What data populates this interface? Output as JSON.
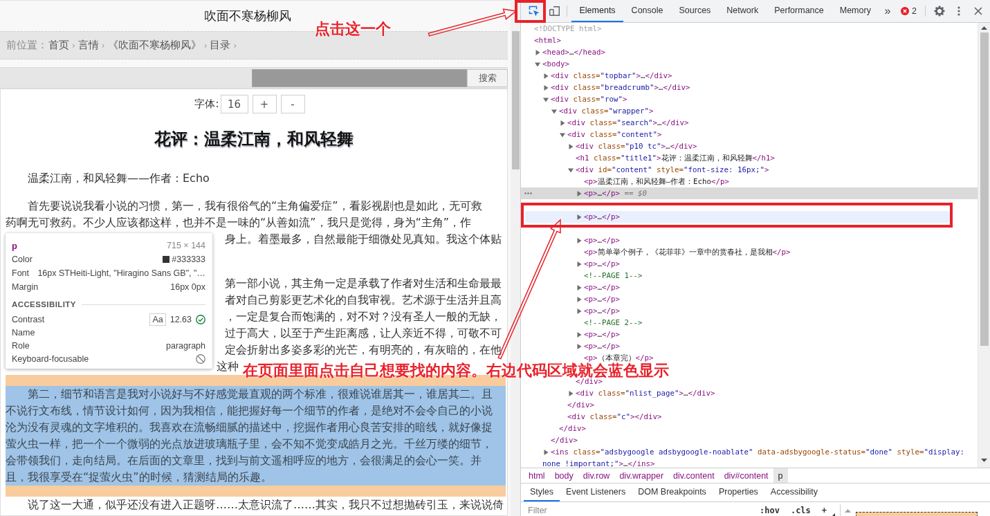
{
  "page": {
    "site_title": "吹面不寒杨柳风",
    "breadcrumb": {
      "label": "前位置：",
      "items": [
        {
          "text": "首页",
          "separator": "›"
        },
        {
          "text": "言情",
          "separator": "›"
        },
        {
          "text": "《吹面不寒杨柳风》",
          "separator": "›"
        },
        {
          "text": "目录",
          "separator": "›"
        }
      ]
    },
    "search": {
      "button": "搜索"
    },
    "font_controls": {
      "label": "字体:",
      "value": "16",
      "buttons": [
        "+",
        "-"
      ]
    },
    "article": {
      "title": "花评：温柔江南，和风轻舞",
      "paragraphs": [
        {
          "highlighted": false,
          "lines": [
            {
              "kind": "full",
              "text": "温柔江南，和风轻舞——作者：Echo"
            }
          ]
        },
        {
          "highlighted": false,
          "lines": [
            {
              "kind": "full",
              "text": "首先要说说我看小说的习惯，第一，我有很俗气的“主角偏爱症”，看影视剧也是如此，无可救"
            },
            {
              "kind": "full",
              "text": "药啊无可救药。不少人应该都这样，也并不是一味的“从善如流”，我只是觉得，身为“主角”，作"
            },
            {
              "kind": "tail",
              "text": "身上。着墨最多，自然最能于细微处见真知。我这个体贴"
            },
            {
              "kind": "covered"
            }
          ]
        },
        {
          "highlighted": false,
          "lines": [
            {
              "kind": "tail",
              "text": "第一部小说，其主角一定是承载了作者对生活和生命最最"
            },
            {
              "kind": "tail",
              "text": "者对自己剪影更艺术化的自我审视。艺术源于生活并且高"
            },
            {
              "kind": "tail",
              "text": "，一定是复合而饱满的，对不对？没有圣人一般的无缺，"
            },
            {
              "kind": "tail",
              "text": "过于高大，以至于产生距离感，让人亲近不得，可敬不可"
            },
            {
              "kind": "tail",
              "text": "定会折射出多姿多彩的光芒，有明亮的，有灰暗的，在他"
            },
            {
              "kind": "middle",
              "text": "这种"
            }
          ]
        },
        {
          "highlighted": true,
          "lines": [
            {
              "kind": "full",
              "text": "第二，细节和语言是我对小说好与不好感觉最直观的两个标准，很难说谁居其一，谁居其二。且"
            },
            {
              "kind": "full",
              "text": "不说行文布线，情节设计如何，因为我相信，能把握好每一个细节的作者，是绝对不会令自己的小说"
            },
            {
              "kind": "full",
              "text": "沦为没有灵魂的文字堆积的。我喜欢在流畅细腻的描述中，挖掘作者用心良苦安排的暗线，就好像捉"
            },
            {
              "kind": "full",
              "text": "萤火虫一样，把一个一个微弱的光点放进玻璃瓶子里，会不知不觉变成皓月之光。千丝万缕的细节，"
            },
            {
              "kind": "full",
              "text": "会带领我们，走向结局。在后面的文章里，找到与前文遥相呼应的地方，会很满足的会心一笑。并"
            },
            {
              "kind": "full",
              "text": "且，我很享受在“捉萤火虫”的时候，猜测结局的乐趣。"
            }
          ]
        },
        {
          "highlighted": false,
          "lines": [
            {
              "kind": "full",
              "text": "说了这一大通，似乎还没有进入正题呀……太意识流了……其实，我只不过想抛砖引玉，来说说倚"
            }
          ]
        }
      ]
    }
  },
  "inspect_tooltip": {
    "tag": "p",
    "size": "715 × 144",
    "rows": [
      {
        "kind": "color",
        "label": "Color",
        "value": "#333333",
        "color": "#333333"
      },
      {
        "kind": "text",
        "label": "Font",
        "value": "16px STHeiti-Light, \"Hiragino Sans GB\", \"…"
      },
      {
        "kind": "text",
        "label": "Margin",
        "value": "16px 0px"
      }
    ],
    "section": "ACCESSIBILITY",
    "a11y_rows": [
      {
        "kind": "contrast",
        "label": "Contrast",
        "sample": "Aa",
        "value": "12.63",
        "passes": true
      },
      {
        "kind": "text",
        "label": "Name"
      },
      {
        "kind": "text",
        "label": "Role",
        "value": "paragraph"
      },
      {
        "kind": "focusable",
        "label": "Keyboard-focusable",
        "focusable": false
      }
    ]
  },
  "devtools": {
    "tools": [
      {
        "kind": "inspect",
        "selected": true,
        "annotated": true
      },
      {
        "kind": "device",
        "selected": false,
        "annotated": false
      }
    ],
    "tabs": [
      {
        "label": "Elements",
        "selected": true
      },
      {
        "label": "Console",
        "selected": false
      },
      {
        "label": "Sources",
        "selected": false
      },
      {
        "label": "Network",
        "selected": false
      },
      {
        "label": "Performance",
        "selected": false
      },
      {
        "label": "Memory",
        "selected": false
      }
    ],
    "more_tabs": "»",
    "error_count": "2",
    "dom_tree": [
      {
        "kind": "doctype",
        "text": "<!DOCTYPE html>",
        "selected": false,
        "hovered": false,
        "annotated": false
      },
      {
        "kind": "element",
        "text": "<html>",
        "selected": false,
        "hovered": false,
        "annotated": false,
        "children": [
          {
            "kind": "toggle",
            "expanded": false,
            "text": "<head>…</head>",
            "selected": false,
            "hovered": false,
            "annotated": false
          },
          {
            "kind": "toggle",
            "expanded": true,
            "text": "<body>",
            "selected": false,
            "hovered": false,
            "annotated": false,
            "children": [
              {
                "kind": "toggle",
                "expanded": false,
                "text": "<div class=\"topbar\">…</div>",
                "selected": false,
                "hovered": false,
                "annotated": false
              },
              {
                "kind": "toggle",
                "expanded": false,
                "text": "<div class=\"breadcrumb\">…</div>",
                "selected": false,
                "hovered": false,
                "annotated": false
              },
              {
                "kind": "toggle",
                "expanded": true,
                "text": "<div class=\"row\">",
                "selected": false,
                "hovered": false,
                "annotated": false,
                "close": "</div>",
                "children": [
                  {
                    "kind": "toggle",
                    "expanded": true,
                    "text": "<div class=\"wrapper\">",
                    "selected": false,
                    "hovered": false,
                    "annotated": false,
                    "close": "</div>",
                    "children": [
                      {
                        "kind": "toggle",
                        "expanded": false,
                        "text": "<div class=\"search\">…</div>",
                        "selected": false,
                        "hovered": false,
                        "annotated": false
                      },
                      {
                        "kind": "toggle",
                        "expanded": true,
                        "text": "<div class=\"content\">",
                        "selected": false,
                        "hovered": false,
                        "annotated": false,
                        "close": "</div>",
                        "children": [
                          {
                            "kind": "toggle",
                            "expanded": false,
                            "text": "<div class=\"p10 tc\">…</div>",
                            "selected": false,
                            "hovered": false,
                            "annotated": false
                          },
                          {
                            "kind": "element",
                            "text": "<h1 class=\"title1\">花评：温柔江南，和风轻舞</h1>",
                            "selected": false,
                            "hovered": false,
                            "annotated": false
                          },
                          {
                            "kind": "toggle",
                            "expanded": true,
                            "text": "<div id=\"content\" style=\"font-size: 16px;\">",
                            "selected": false,
                            "hovered": false,
                            "annotated": false,
                            "close": "</div>",
                            "children": [
                              {
                                "kind": "element",
                                "text": "<p>温柔江南，和风轻舞—作者：Echo</p>",
                                "selected": false,
                                "hovered": false,
                                "annotated": false
                              },
                              {
                                "kind": "toggle",
                                "expanded": false,
                                "text": "<p>…</p>",
                                "selected": true,
                                "hovered": false,
                                "annotated": false,
                                "suffix": "== $0"
                              },
                              {
                                "kind": "obscured"
                              },
                              {
                                "kind": "toggle",
                                "expanded": false,
                                "text": "<p>…</p>",
                                "selected": false,
                                "hovered": true,
                                "annotated": true
                              },
                              {
                                "kind": "obscured"
                              },
                              {
                                "kind": "toggle",
                                "expanded": false,
                                "text": "<p>…</p>",
                                "selected": false,
                                "hovered": false,
                                "annotated": false
                              },
                              {
                                "kind": "element",
                                "text": "<p>简单举个例子，《花菲菲》一章中的赏春社，是我相</p>",
                                "selected": false,
                                "hovered": false,
                                "annotated": false
                              },
                              {
                                "kind": "toggle",
                                "expanded": false,
                                "text": "<p>…</p>",
                                "selected": false,
                                "hovered": false,
                                "annotated": false
                              },
                              {
                                "kind": "comment",
                                "text": "<!--PAGE 1-->",
                                "selected": false,
                                "hovered": false,
                                "annotated": false
                              },
                              {
                                "kind": "toggle",
                                "expanded": false,
                                "text": "<p>…</p>",
                                "selected": false,
                                "hovered": false,
                                "annotated": false
                              },
                              {
                                "kind": "toggle",
                                "expanded": false,
                                "text": "<p>…</p>",
                                "selected": false,
                                "hovered": false,
                                "annotated": false
                              },
                              {
                                "kind": "toggle",
                                "expanded": false,
                                "text": "<p>…</p>",
                                "selected": false,
                                "hovered": false,
                                "annotated": false
                              },
                              {
                                "kind": "comment",
                                "text": "<!--PAGE 2-->",
                                "selected": false,
                                "hovered": false,
                                "annotated": false
                              },
                              {
                                "kind": "toggle",
                                "expanded": false,
                                "text": "<p>…</p>",
                                "selected": false,
                                "hovered": false,
                                "annotated": false
                              },
                              {
                                "kind": "toggle",
                                "expanded": false,
                                "text": "<p>…</p>",
                                "selected": false,
                                "hovered": false,
                                "annotated": false
                              },
                              {
                                "kind": "element",
                                "text": "<p>（本章完）</p>",
                                "selected": false,
                                "hovered": false,
                                "annotated": false
                              },
                              {
                                "kind": "obscured"
                              }
                            ]
                          },
                          {
                            "kind": "toggle",
                            "expanded": false,
                            "text": "<div class=\"nlist_page\">…</div>",
                            "selected": false,
                            "hovered": false,
                            "annotated": false
                          }
                        ]
                      },
                      {
                        "kind": "element",
                        "text": "<div class=\"c\"></div>",
                        "selected": false,
                        "hovered": false,
                        "annotated": false
                      }
                    ]
                  }
                ]
              },
              {
                "kind": "toggle",
                "expanded": false,
                "text": "<ins class=\"adsbygoogle adsbygoogle-noablate\" data-adsbygoogle-status=\"done\" style=\"display: none !important;\">…</ins>",
                "selected": false,
                "hovered": false,
                "annotated": false
              }
            ]
          }
        ]
      }
    ],
    "element_path": [
      {
        "label": "html",
        "selected": false
      },
      {
        "label": "body",
        "selected": false
      },
      {
        "label": "div.row",
        "selected": false
      },
      {
        "label": "div.wrapper",
        "selected": false
      },
      {
        "label": "div.content",
        "selected": false
      },
      {
        "label": "div#content",
        "selected": false
      },
      {
        "label": "p",
        "selected": true
      }
    ],
    "panel_tabs": [
      {
        "label": "Styles",
        "selected": true
      },
      {
        "label": "Event Listeners",
        "selected": false
      },
      {
        "label": "DOM Breakpoints",
        "selected": false
      },
      {
        "label": "Properties",
        "selected": false
      },
      {
        "label": "Accessibility",
        "selected": false
      }
    ],
    "filter": {
      "placeholder": "Filter"
    },
    "style_buttons": [
      ":hov",
      ".cls",
      "+"
    ]
  },
  "annotations": [
    {
      "kind": "note",
      "text": "点击这一个"
    },
    {
      "kind": "arrow"
    },
    {
      "kind": "note",
      "text": "在页面里面点击自己想要找的内容。右边代码区域就会蓝色显示"
    },
    {
      "kind": "arrow"
    }
  ]
}
